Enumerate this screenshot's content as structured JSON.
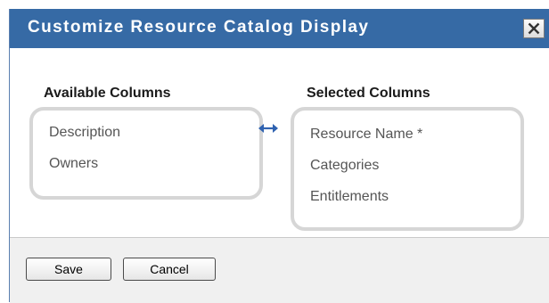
{
  "dialog": {
    "title": "Customize Resource Catalog Display",
    "close_label": "×"
  },
  "available": {
    "heading": "Available Columns",
    "items": [
      "Description",
      "Owners"
    ]
  },
  "selected": {
    "heading": "Selected Columns",
    "items": [
      "Resource Name *",
      "Categories",
      "Entitlements"
    ]
  },
  "buttons": {
    "save": "Save",
    "cancel": "Cancel"
  },
  "icons": {
    "close": "close-icon",
    "swap": "swap-arrows-icon"
  },
  "colors": {
    "titlebar": "#366aa5",
    "panel_border": "#d6d6d6",
    "swap_arrow": "#2f62b0"
  }
}
